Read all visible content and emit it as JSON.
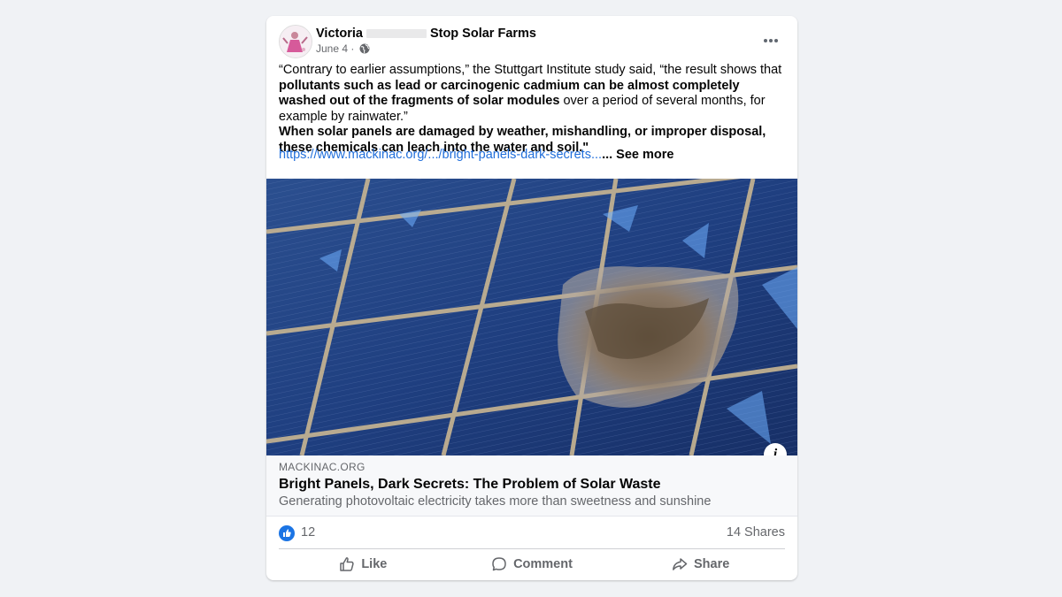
{
  "post": {
    "author_first": "Victoria",
    "group": "Stop Solar Farms",
    "date": "June 4 ·",
    "audience_icon": "globe-icon",
    "text": {
      "p1_a": "“Contrary to earlier assumptions,” the Stuttgart Institute study said, “the result shows that ",
      "p1_bold": "pollutants such as lead or carcinogenic cadmium can be almost completely washed out of the fragments of solar modules",
      "p1_b": " over a period of several months, for example by rainwater.”",
      "p2_bold": "When solar panels are damaged by weather, mishandling, or improper disposal, these chemicals can leach into the water and soil.\""
    },
    "link": "https://www.mackinac.org/.../bright-panels-dark-secrets...",
    "see_more": "... See more"
  },
  "link_preview": {
    "domain": "MACKINAC.ORG",
    "title": "Bright Panels, Dark Secrets: The Problem of Solar Waste",
    "description": "Generating photovoltaic electricity takes more than sweetness and sunshine",
    "info_label": "i"
  },
  "stats": {
    "reaction_icon": "like-reaction-icon",
    "likes": "12",
    "shares": "14 Shares"
  },
  "actions": {
    "like": "Like",
    "comment": "Comment",
    "share": "Share"
  },
  "colors": {
    "background": "#f0f2f5",
    "link": "#216fdb",
    "like_blue": "#1b74e4",
    "muted_text": "#65676b"
  }
}
